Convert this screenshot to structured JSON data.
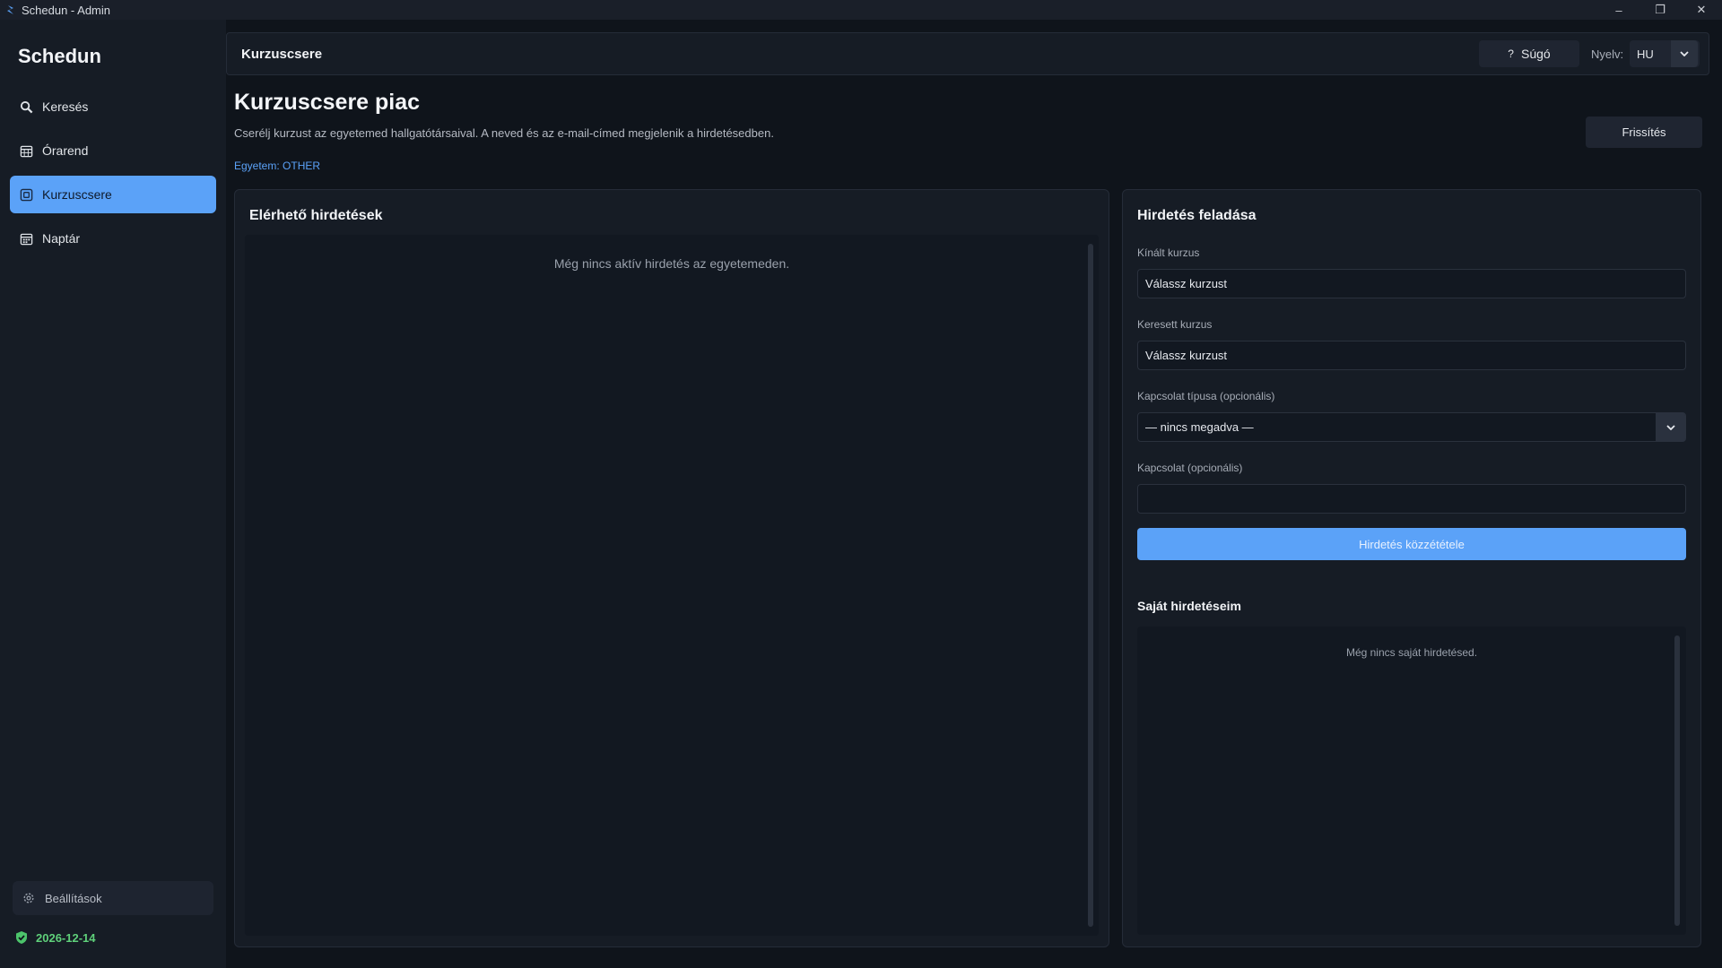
{
  "window": {
    "title": "Schedun - Admin",
    "controls": {
      "minimize": "–",
      "restore": "❐",
      "close": "✕"
    }
  },
  "sidebar": {
    "brand": "Schedun",
    "items": [
      {
        "label": "Keresés",
        "icon": "search-icon"
      },
      {
        "label": "Órarend",
        "icon": "timetable-icon"
      },
      {
        "label": "Kurzuscsere",
        "icon": "exchange-icon",
        "active": true
      },
      {
        "label": "Naptár",
        "icon": "calendar-icon"
      }
    ],
    "settings_label": "Beállítások",
    "license_date": "2026-12-14"
  },
  "header": {
    "title": "Kurzuscsere",
    "help_label": "Súgó",
    "help_glyph": "?",
    "lang_label": "Nyelv:",
    "lang_value": "HU"
  },
  "page": {
    "title": "Kurzuscsere piac",
    "description": "Cserélj kurzust az egyetemed hallgatótársaival. A neved és az e-mail-címed megjelenik a hirdetésedben.",
    "university": "Egyetem: OTHER",
    "refresh_label": "Frissítés"
  },
  "listings": {
    "title": "Elérhető hirdetések",
    "empty": "Még nincs aktív hirdetés az egyetemeden."
  },
  "post_form": {
    "title": "Hirdetés feladása",
    "offered_label": "Kínált kurzus",
    "offered_value": "Válassz kurzust",
    "wanted_label": "Keresett kurzus",
    "wanted_value": "Válassz kurzust",
    "contact_type_label": "Kapcsolat típusa (opcionális)",
    "contact_type_value": "— nincs megadva —",
    "contact_label": "Kapcsolat (opcionális)",
    "contact_value": "",
    "submit_label": "Hirdetés közzététele"
  },
  "my_listings": {
    "title": "Saját hirdetéseim",
    "empty": "Még nincs saját hirdetésed."
  },
  "colors": {
    "accent": "#5ba2f8",
    "background": "#0f141b",
    "panel": "#161c25",
    "license_ok": "#5fd07a"
  }
}
